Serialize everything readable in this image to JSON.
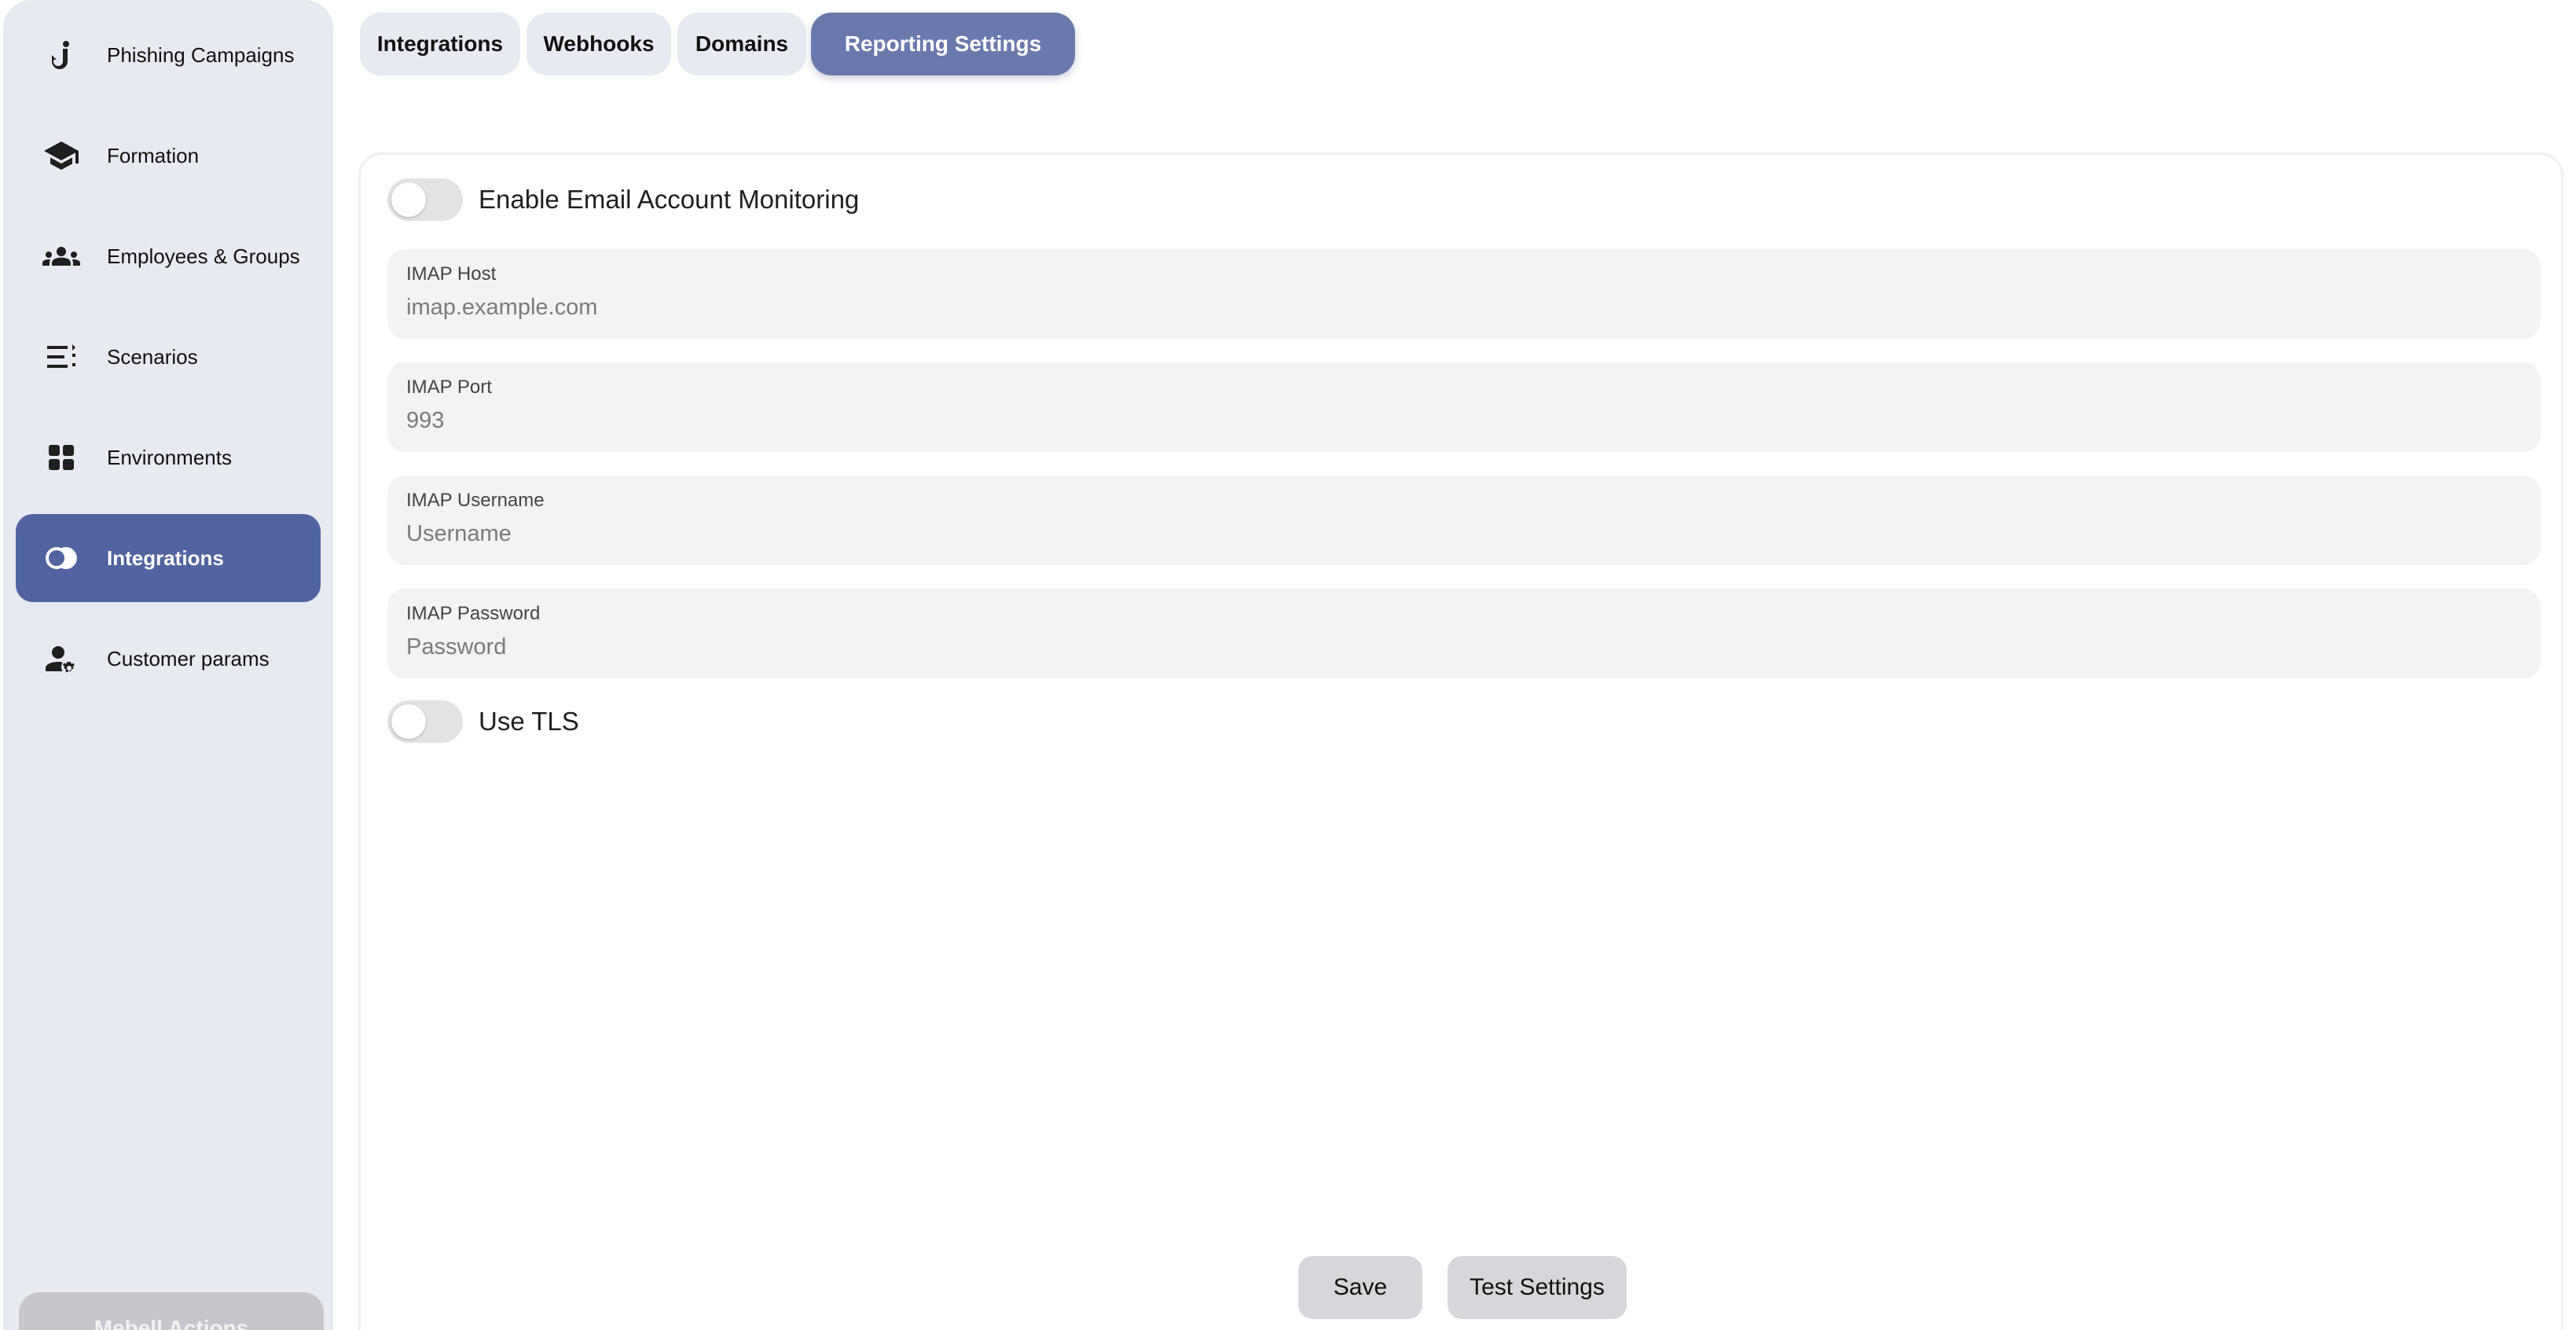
{
  "sidebar": {
    "items": [
      {
        "label": "Phishing Campaigns",
        "icon": "fishing-hook-icon",
        "active": false
      },
      {
        "label": "Formation",
        "icon": "graduation-cap-icon",
        "active": false
      },
      {
        "label": "Employees & Groups",
        "icon": "groups-icon",
        "active": false
      },
      {
        "label": "Scenarios",
        "icon": "list-icon",
        "active": false
      },
      {
        "label": "Environments",
        "icon": "grid-icon",
        "active": false
      },
      {
        "label": "Integrations",
        "icon": "integration-icon",
        "active": true
      },
      {
        "label": "Customer params",
        "icon": "user-settings-icon",
        "active": false
      }
    ],
    "bottom_button": "Mebell Actions"
  },
  "tabs": [
    {
      "label": "Integrations",
      "active": false
    },
    {
      "label": "Webhooks",
      "active": false
    },
    {
      "label": "Domains",
      "active": false
    },
    {
      "label": "Reporting Settings",
      "active": true
    }
  ],
  "form": {
    "monitoring_toggle": {
      "label": "Enable Email Account Monitoring",
      "on": false
    },
    "fields": [
      {
        "label": "IMAP Host",
        "value": "",
        "placeholder": "imap.example.com"
      },
      {
        "label": "IMAP Port",
        "value": "",
        "placeholder": "993"
      },
      {
        "label": "IMAP Username",
        "value": "",
        "placeholder": "Username"
      },
      {
        "label": "IMAP Password",
        "value": "",
        "placeholder": "Password"
      }
    ],
    "tls_toggle": {
      "label": "Use TLS",
      "on": false
    },
    "save_label": "Save",
    "test_label": "Test Settings"
  },
  "colors": {
    "accent": "#5163a0",
    "tab_active": "#6a79ad",
    "sidebar_bg": "#e8eaf2"
  }
}
